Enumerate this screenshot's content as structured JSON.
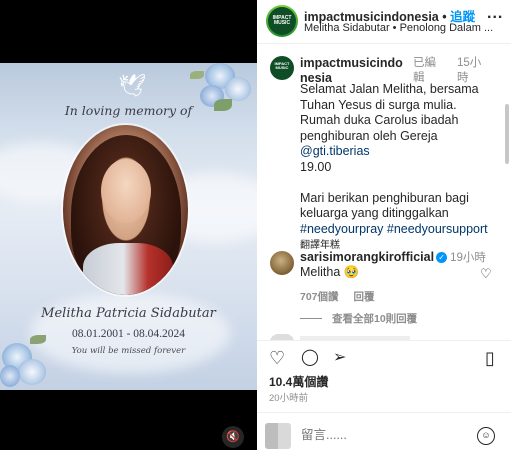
{
  "media": {
    "dove": "🕊",
    "memory_title": "In loving memory of",
    "name": "Melitha Patricia Sidabutar",
    "dates": "08.01.2001 - 08.04.2024",
    "missed": "You will be missed forever",
    "mute_icon": "🔇"
  },
  "header": {
    "avatar_text": "IMPACT MUSIC",
    "username": "impactmusicindonesia",
    "dot": "•",
    "follow": "追蹤",
    "subtitle": "Melitha Sidabutar • Penolong Dalam ...",
    "more": "..."
  },
  "caption": {
    "avatar_text": "IMPACT MUSIC",
    "username": "impactmusicindonesia",
    "edited": "已編輯",
    "time": "15小時",
    "lines": [
      "Selamat Jalan Melitha, bersama",
      "Tuhan Yesus di surga mulia.",
      "Rumah duka Carolus ibadah",
      "penghiburan oleh Gereja"
    ],
    "mention": "@gti.tiberias",
    "hour": "19.00",
    "lines2": [
      "Mari berikan penghiburan bagi",
      "keluarga yang ditinggalkan"
    ],
    "hashtags": "#needyourpray #needyoursupport",
    "translate": "翻譯年糕"
  },
  "comment": {
    "username": "sarisimorangkirofficial",
    "verified": "✓",
    "time": "19小時",
    "text": "Melitha 🥹",
    "likes": "707個讚",
    "reply": "回覆"
  },
  "view_all": "查看全部10則回覆",
  "actions": {
    "like_icon": "♡",
    "comment_icon": "◯",
    "share_icon": "➢",
    "save_icon": "▯"
  },
  "stats": {
    "views": "10.4萬個讚",
    "ago": "20小時前"
  },
  "comment_box": {
    "placeholder": "留言......",
    "emoji": "☺"
  }
}
